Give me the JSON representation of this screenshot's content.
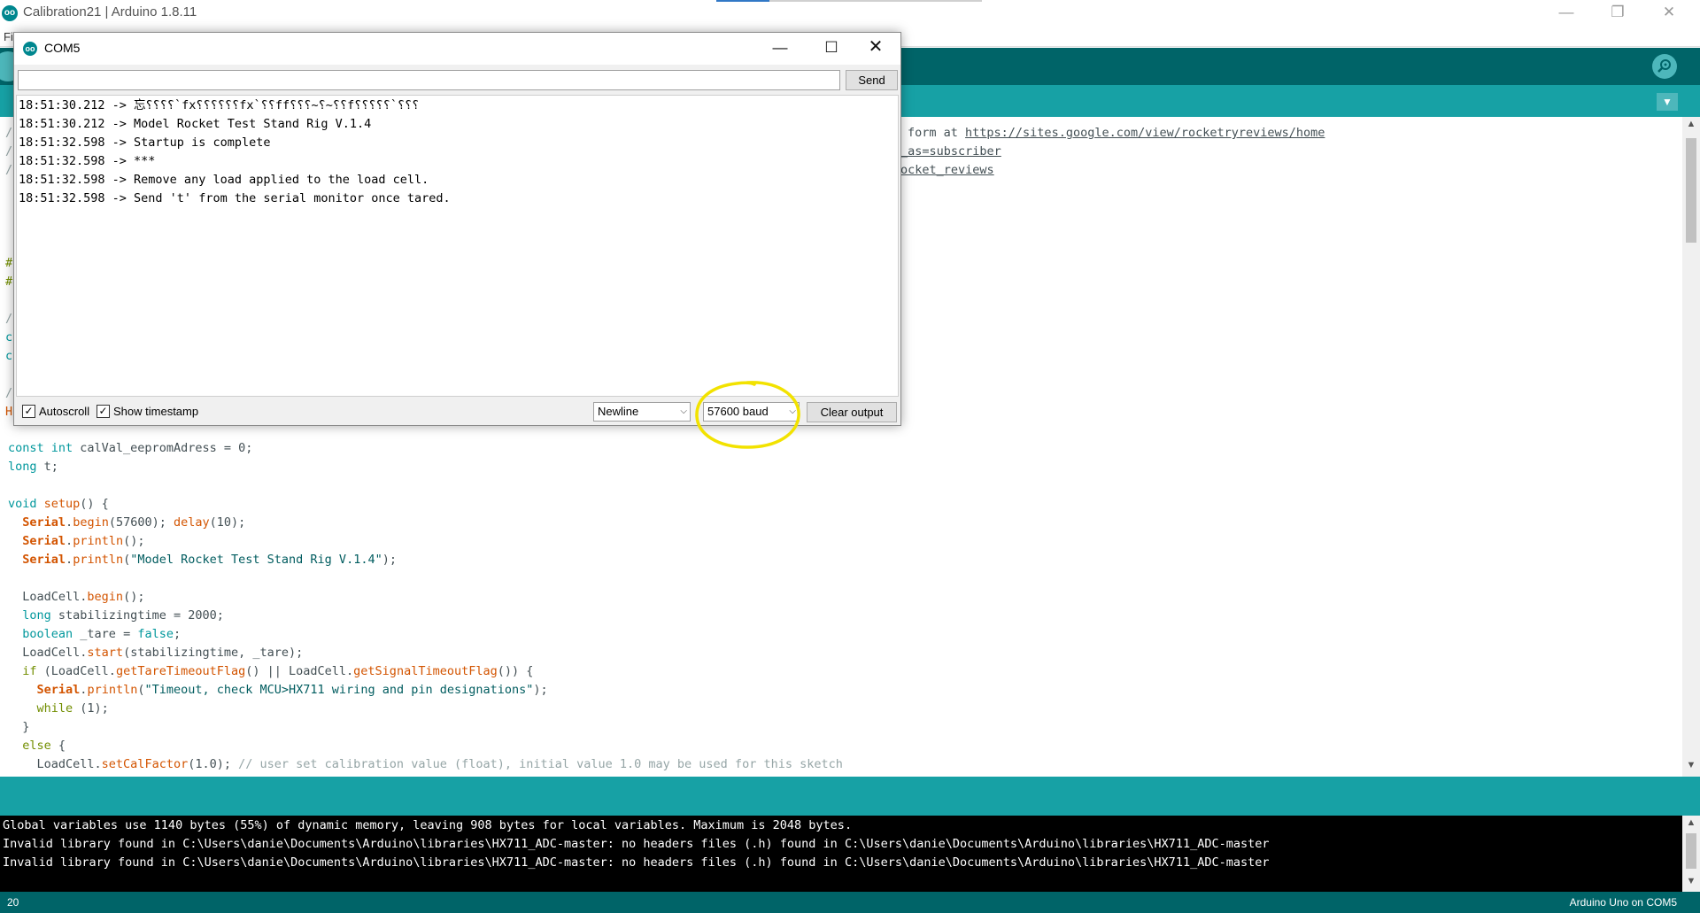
{
  "window": {
    "title": "Calibration21 | Arduino 1.8.11",
    "logo": "oo",
    "controls": {
      "minimize": "—",
      "maximize": "❐",
      "close": "✕"
    }
  },
  "menu": {
    "first_item": "Fi"
  },
  "toolbar": {
    "serial_monitor_icon": "magnifier-icon"
  },
  "tab_bar": {
    "menu_arrow": "▼"
  },
  "editor": {
    "url_text": "form at ",
    "url_link": "https://sites.google.com/view/rocketryreviews/home",
    "partial_line_2": "_as=subscriber",
    "partial_line_3": "ocket_reviews",
    "edge_glyphs": [
      "/",
      "/",
      "/",
      "#",
      "#",
      "/",
      "c",
      "c",
      "/",
      "H"
    ],
    "code": {
      "l1_kw": "const int",
      "l1_rest": " calVal_eepromAdress = 0;",
      "l2_kw": "long",
      "l2_rest": " t;",
      "l3_kw1": "void",
      "l3_fn": "setup",
      "l3_rest": "() {",
      "l4_obj": "Serial",
      "l4_dot": ".",
      "l4_fn": "begin",
      "l4_mid": "(57600); ",
      "l4_fn2": "delay",
      "l4_end": "(10);",
      "l5_obj": "Serial",
      "l5_dot": ".",
      "l5_fn": "println",
      "l5_end": "();",
      "l6_obj": "Serial",
      "l6_dot": ".",
      "l6_fn": "println",
      "l6_open": "(",
      "l6_str": "\"Model Rocket Test Stand Rig V.1.4\"",
      "l6_end": ");",
      "l7_a": "LoadCell.",
      "l7_fn": "begin",
      "l7_end": "();",
      "l8_kw": "long",
      "l8_rest": " stabilizingtime = 2000;",
      "l9_kw": "boolean",
      "l9_mid": " _tare = ",
      "l9_kw2": "false",
      "l9_end": ";",
      "l10_a": "LoadCell.",
      "l10_fn": "start",
      "l10_end": "(stabilizingtime, _tare);",
      "l11_kw": "if",
      "l11_a": " (LoadCell.",
      "l11_fn": "getTareTimeoutFlag",
      "l11_b": "() || LoadCell.",
      "l11_fn2": "getSignalTimeoutFlag",
      "l11_end": "()) {",
      "l12_obj": "Serial",
      "l12_dot": ".",
      "l12_fn": "println",
      "l12_open": "(",
      "l12_str": "\"Timeout, check MCU>HX711 wiring and pin designations\"",
      "l12_end": ");",
      "l13_kw": "while",
      "l13_end": " (1);",
      "l14": "}",
      "l15_kw": "else",
      "l15_end": " {",
      "l16_a": "LoadCell.",
      "l16_fn": "setCalFactor",
      "l16_mid": "(1.0); ",
      "l16_cmt": "// user set calibration value (float), initial value 1.0 may be used for this sketch"
    }
  },
  "console": {
    "lines": [
      "Global variables use 1140 bytes (55%) of dynamic memory, leaving 908 bytes for local variables. Maximum is 2048 bytes.",
      "Invalid library found in C:\\Users\\danie\\Documents\\Arduino\\libraries\\HX711_ADC-master: no headers files (.h) found in C:\\Users\\danie\\Documents\\Arduino\\libraries\\HX711_ADC-master",
      "Invalid library found in C:\\Users\\danie\\Documents\\Arduino\\libraries\\HX711_ADC-master: no headers files (.h) found in C:\\Users\\danie\\Documents\\Arduino\\libraries\\HX711_ADC-master"
    ]
  },
  "status_bar": {
    "line_number": "20",
    "board_port": "Arduino Uno on COM5"
  },
  "serial_monitor": {
    "title": "COM5",
    "logo": "oo",
    "controls": {
      "minimize": "—",
      "maximize": "☐",
      "close": "✕"
    },
    "input_value": "",
    "send_label": "Send",
    "output_lines": [
      "18:51:30.212 -> 忘⸮⸮⸮⸮`fx⸮⸮⸮⸮⸮⸮fx`⸮⸮ff⸮⸮⸮~⸮~⸮⸮f⸮⸮⸮⸮⸮`⸮⸮⸮",
      "18:51:30.212 -> Model Rocket Test Stand Rig V.1.4",
      "18:51:32.598 -> Startup is complete",
      "18:51:32.598 -> ***",
      "18:51:32.598 -> Remove any load applied to the load cell.",
      "18:51:32.598 -> Send 't' from the serial monitor once tared."
    ],
    "autoscroll_label": "Autoscroll",
    "autoscroll_checked": true,
    "timestamp_label": "Show timestamp",
    "timestamp_checked": true,
    "check_mark": "✓",
    "line_ending": "Newline",
    "baud_rate": "57600 baud",
    "select_arrow": "⌵",
    "clear_output_label": "Clear output",
    "highlight_color": "#f2e200"
  },
  "colors": {
    "toolbar": "#006468",
    "tab_bar": "#17a1a5",
    "keyword_blue": "#00979c",
    "keyword_orange": "#d35400",
    "keyword_green": "#728e00"
  }
}
